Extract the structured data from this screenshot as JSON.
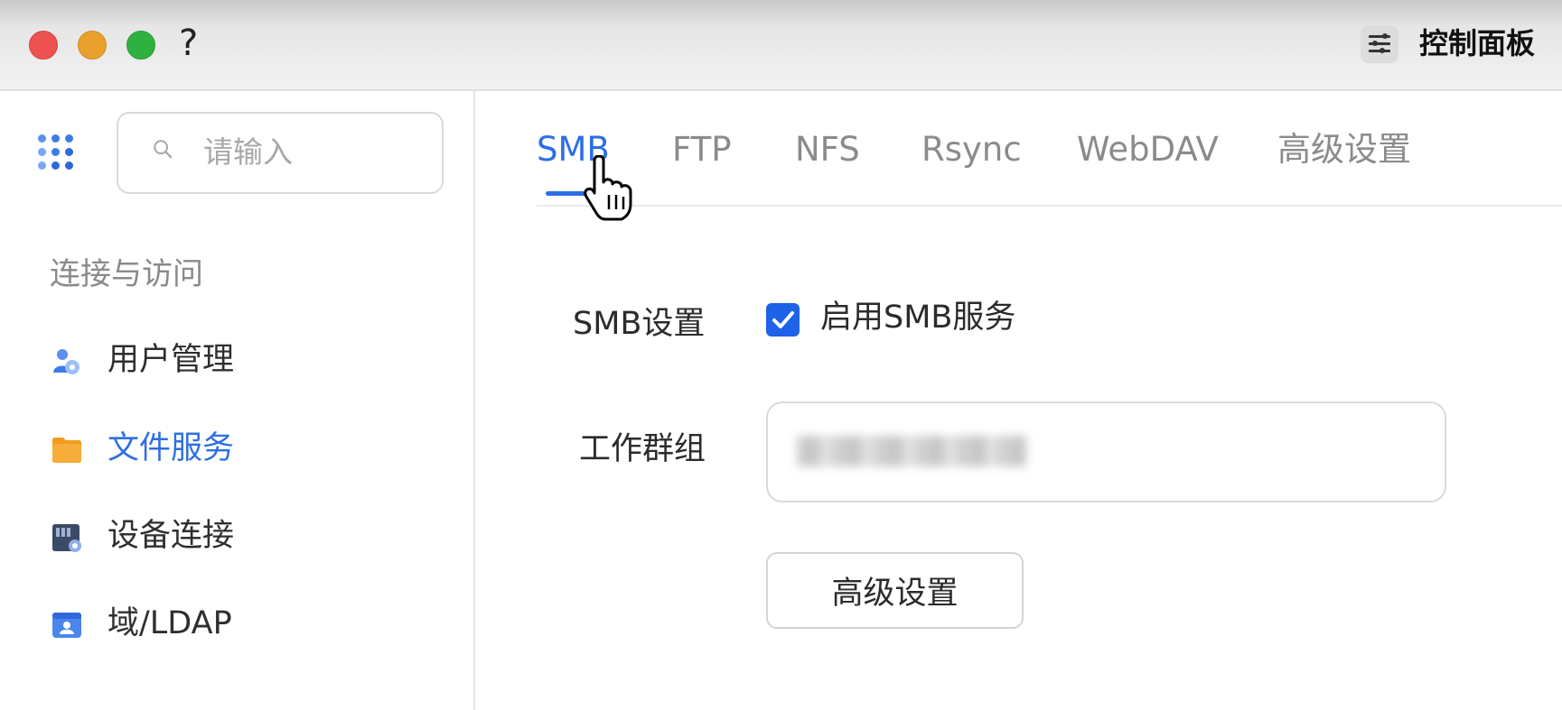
{
  "window": {
    "help_glyph": "?",
    "title": "控制面板",
    "title_icon": "sliders-icon"
  },
  "sidebar": {
    "apps_icon": "grid-dots-icon",
    "search": {
      "placeholder": "请输入",
      "icon": "search-icon"
    },
    "section_label": "连接与访问",
    "items": [
      {
        "label": "用户管理",
        "icon": "users-icon",
        "active": false
      },
      {
        "label": "文件服务",
        "icon": "folder-icon",
        "active": true
      },
      {
        "label": "设备连接",
        "icon": "device-icon",
        "active": false
      },
      {
        "label": "域/LDAP",
        "icon": "id-card-icon",
        "active": false
      }
    ]
  },
  "tabs": [
    {
      "label": "SMB",
      "active": true
    },
    {
      "label": "FTP",
      "active": false
    },
    {
      "label": "NFS",
      "active": false
    },
    {
      "label": "Rsync",
      "active": false
    },
    {
      "label": "WebDAV",
      "active": false
    },
    {
      "label": "高级设置",
      "active": false
    }
  ],
  "form": {
    "smb_settings_label": "SMB设置",
    "enable_smb": {
      "label": "启用SMB服务",
      "checked": true
    },
    "workgroup_label": "工作群组",
    "workgroup_value_blurred": true,
    "advanced_button": "高级设置"
  },
  "colors": {
    "accent": "#2d6ee6",
    "checkbox": "#1d62e8",
    "traffic_red": "#ee5250",
    "traffic_yellow": "#e9a12d",
    "traffic_green": "#2fb140"
  }
}
